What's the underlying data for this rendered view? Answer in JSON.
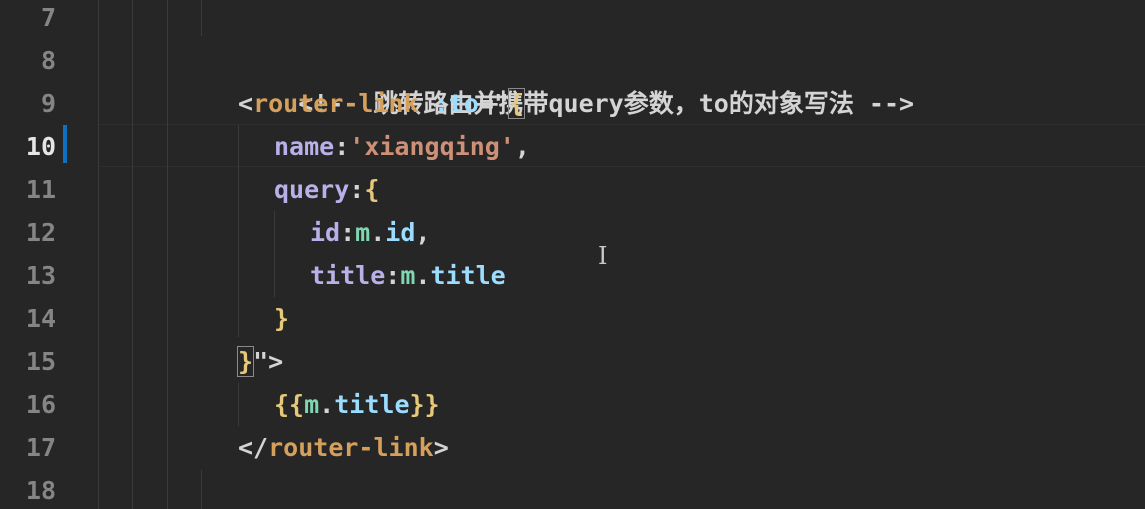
{
  "editor": {
    "active_line": "10",
    "line_numbers": [
      "7",
      "8",
      "9",
      "10",
      "11",
      "12",
      "13",
      "14",
      "15",
      "16",
      "17",
      "18"
    ],
    "lines": {
      "l8": {
        "comment": "<!-- 跳转路由并携带query参数，to的对象写法 -->"
      },
      "l9": {
        "open_angle": "<",
        "tag": "router-link",
        "space": " ",
        "attr": ":to",
        "eq_quote": "=\"",
        "brace": "{"
      },
      "l10": {
        "prop": "name",
        "colon": ":",
        "value": "'xiangqing'",
        "comma": ","
      },
      "l11": {
        "prop": "query",
        "colon": ":",
        "brace": "{"
      },
      "l12": {
        "prop": "id",
        "colon": ":",
        "obj": "m",
        "dot": ".",
        "member": "id",
        "comma": ","
      },
      "l13": {
        "prop": "title",
        "colon": ":",
        "obj": "m",
        "dot": ".",
        "member": "title"
      },
      "l14": {
        "brace": "}"
      },
      "l15": {
        "brace": "}",
        "close": "\">"
      },
      "l16": {
        "open": "{{",
        "obj": "m",
        "dot": ".",
        "member": "title",
        "close": "}}"
      },
      "l17": {
        "open_angle": "</",
        "tag": "router-link",
        "close_angle": ">"
      }
    },
    "cursor_glyph": "I"
  }
}
